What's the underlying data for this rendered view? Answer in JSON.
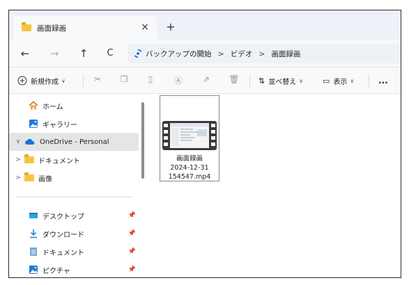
{
  "tab": {
    "title": "画面録画",
    "close": "×",
    "new_tab": "+"
  },
  "nav": {
    "back": "←",
    "forward": "→",
    "up": "↑",
    "refresh": "C"
  },
  "address": {
    "crumbs": [
      "バックアップの開始",
      "ビデオ",
      "画面録画"
    ],
    "separator": ">"
  },
  "commands": {
    "new": "新規作成",
    "sort": "並べ替え",
    "view": "表示",
    "more": "..."
  },
  "sidebar": {
    "items": [
      {
        "label": "ホーム",
        "icon": "home-icon"
      },
      {
        "label": "ギャラリー",
        "icon": "gallery-icon"
      },
      {
        "label": "OneDrive - Personal",
        "icon": "cloud-icon",
        "expander": "∨"
      },
      {
        "label": "ドキュメント",
        "icon": "folder-icon",
        "expander": ">"
      },
      {
        "label": "画像",
        "icon": "folder-icon",
        "expander": ">"
      }
    ],
    "pinned": [
      {
        "label": "デスクトップ",
        "icon": "desktop-icon"
      },
      {
        "label": "ダウンロード",
        "icon": "download-icon"
      },
      {
        "label": "ドキュメント",
        "icon": "document-icon"
      },
      {
        "label": "ピクチャ",
        "icon": "pictures-icon"
      }
    ]
  },
  "file": {
    "line1": "画面録画",
    "line2": "2024-12-31",
    "line3": "154547.mp4",
    "icon": "video-file-icon"
  }
}
